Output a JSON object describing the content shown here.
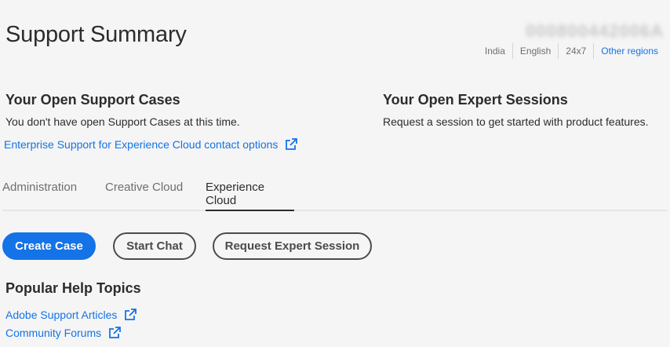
{
  "header": {
    "title": "Support Summary",
    "account_id": "000800442006A",
    "regions": [
      "India",
      "English",
      "24x7"
    ],
    "other_regions": "Other regions"
  },
  "support_cases": {
    "title": "Your Open Support Cases",
    "text": "You don't have open Support Cases at this time.",
    "link": "Enterprise Support for Experience Cloud contact options"
  },
  "expert_sessions": {
    "title": "Your Open Expert Sessions",
    "text": "Request a session to get started with product features."
  },
  "tabs": [
    {
      "label": "Administration"
    },
    {
      "label": "Creative Cloud"
    },
    {
      "label": "Experience Cloud",
      "active": true
    }
  ],
  "actions": {
    "create_case": "Create Case",
    "start_chat": "Start Chat",
    "request_expert": "Request Expert Session"
  },
  "help": {
    "title": "Popular Help Topics",
    "links": [
      "Adobe Support Articles",
      "Community Forums"
    ]
  },
  "colors": {
    "accent": "#1473e6",
    "text": "#2c2c2c",
    "background": "#f5f5f5"
  }
}
